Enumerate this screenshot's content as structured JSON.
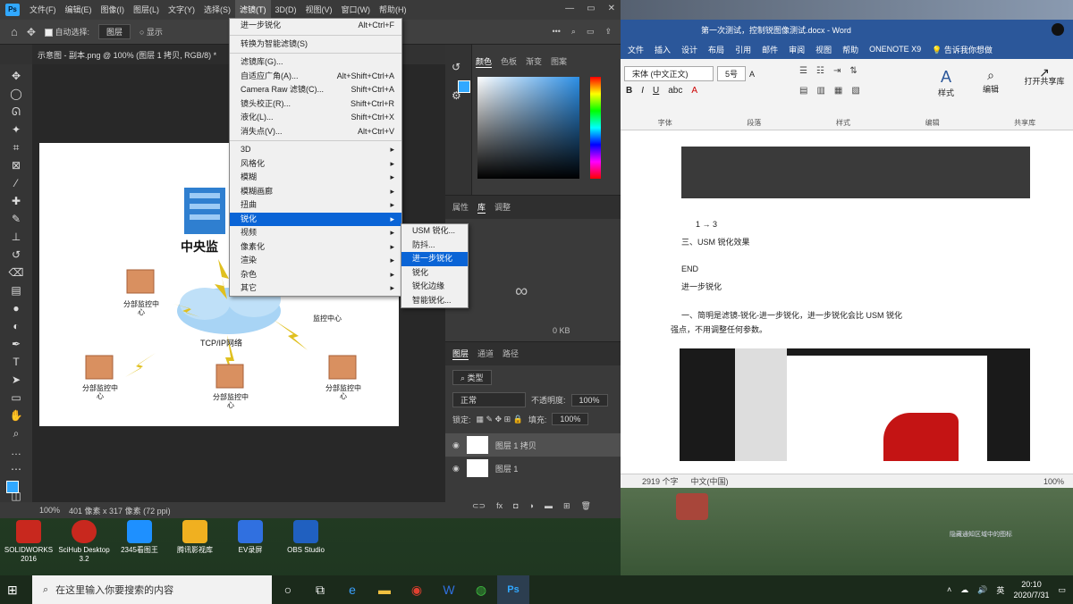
{
  "photoshop": {
    "menubar": [
      "文件(F)",
      "编辑(E)",
      "图像(I)",
      "图层(L)",
      "文字(Y)",
      "选择(S)",
      "滤镜(T)",
      "3D(D)",
      "视图(V)",
      "窗口(W)",
      "帮助(H)"
    ],
    "options": {
      "auto_select_label": "自动选择:",
      "auto_select_value": "图层",
      "show_transform": "显示"
    },
    "doc_tab": "示意图 - 副本.png @ 100% (图层 1 拷贝, RGB/8) *",
    "status_zoom": "100%",
    "status_doc": "401 像素 x 317 像素 (72 ppi)",
    "filter_menu": {
      "items": [
        {
          "label": "进一步锐化",
          "shortcut": "Alt+Ctrl+F"
        },
        {
          "label": "转换为智能滤镜(S)",
          "shortcut": ""
        },
        {
          "label": "滤镜库(G)...",
          "shortcut": ""
        },
        {
          "label": "自适应广角(A)...",
          "shortcut": "Alt+Shift+Ctrl+A"
        },
        {
          "label": "Camera Raw 滤镜(C)...",
          "shortcut": "Shift+Ctrl+A"
        },
        {
          "label": "镜头校正(R)...",
          "shortcut": "Shift+Ctrl+R"
        },
        {
          "label": "液化(L)...",
          "shortcut": "Shift+Ctrl+X"
        },
        {
          "label": "消失点(V)...",
          "shortcut": "Alt+Ctrl+V"
        }
      ],
      "submenus": [
        "3D",
        "风格化",
        "模糊",
        "模糊画廊",
        "扭曲",
        "锐化",
        "视频",
        "像素化",
        "渲染",
        "杂色",
        "其它"
      ]
    },
    "sharpen_menu": [
      "USM 锐化...",
      "防抖...",
      "进一步锐化",
      "锐化",
      "锐化边缘",
      "智能锐化..."
    ],
    "color_tabs": [
      "颜色",
      "色板",
      "渐变",
      "图案"
    ],
    "props_tabs": [
      "属性",
      "库",
      "调整"
    ],
    "layers_tabs": [
      "图层",
      "通道",
      "路径"
    ],
    "layers_kind": "类型",
    "blend_mode": "正常",
    "opacity_label": "不透明度:",
    "opacity_value": "100%",
    "lock_label": "锁定:",
    "fill_label": "填充:",
    "fill_value": "100%",
    "layers": [
      "图层 1 拷贝",
      "图层 1"
    ],
    "props_kb": "0 KB",
    "canvas": {
      "center_title": "中央监",
      "network_label": "TCP/IP网络",
      "node_labels": [
        "分部监控中心",
        "分部监控中心",
        "分部监控中心",
        "分部监控中心",
        "监控中心"
      ]
    }
  },
  "word": {
    "title": "第一次测试，控制锐图像测试.docx - Word",
    "tabs": [
      "文件",
      "插入",
      "设计",
      "布局",
      "引用",
      "邮件",
      "审阅",
      "视图",
      "帮助",
      "ONENOTE X9",
      "告诉我你想做"
    ],
    "font_name": "宋体 (中文正文)",
    "font_size": "5号",
    "groups": [
      "字体",
      "段落",
      "样式",
      "编辑",
      "共享库"
    ],
    "styles_label": "样式",
    "editing_label": "编辑",
    "open_label": "打开共享库",
    "doc_lines": [
      "1 → 3",
      "三、USM 锐化效果",
      "END",
      "进一步锐化",
      "一、简明是滤镜-锐化-进一步锐化，进一步锐化会比 USM 锐化",
      "强点，不用调整任何参数。"
    ],
    "status_words": "2919 个字",
    "status_lang": "中文(中国)",
    "zoom": "100%"
  },
  "desktop_icons": [
    {
      "label": "SOLIDWORKS 2016",
      "color": "#c8281e"
    },
    {
      "label": "SciHub Desktop 3.2",
      "color": "#c8281e"
    },
    {
      "label": "2345看图王",
      "color": "#1e90ff"
    },
    {
      "label": "腾讯影视库",
      "color": "#f0b020"
    },
    {
      "label": "EV录屏",
      "color": "#3070e0"
    },
    {
      "label": "OBS Studio",
      "color": "#2060c0"
    }
  ],
  "taskbar": {
    "search_placeholder": "在这里输入你要搜索的内容",
    "time": "20:10",
    "date": "2020/7/31",
    "ime": "英"
  },
  "notice": "隐藏通知区域中的图标"
}
